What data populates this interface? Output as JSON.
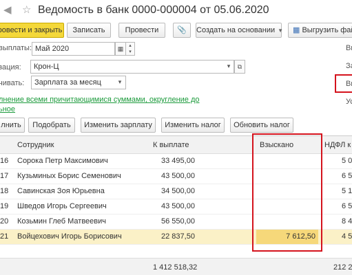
{
  "window": {
    "title": "Ведомость в банк 0000-000004 от 05.06.2020"
  },
  "toolbar": {
    "post_close": "ровести и закрыть",
    "write": "Записать",
    "post": "Провести",
    "create_based": "Создать на основании",
    "upload": "Выгрузить файл"
  },
  "form": {
    "month_label": "выплаты:",
    "month_value": "Май 2020",
    "org_label": "зация:",
    "org_value": "Крон-Ц",
    "pay_label": "чивать:",
    "pay_value": "Зарплата за месяц",
    "fill_link": "лнение всеми причитающимися суммами, округление до",
    "fill_link_2": "ьное",
    "right_1": "Вы",
    "right_2": "За",
    "right_3": "Вы",
    "right_4": "Ус"
  },
  "actions": {
    "fill": "лнить",
    "select": "Подобрать",
    "change_salary": "Изменить зарплату",
    "change_tax": "Изменить налог",
    "update_tax": "Обновить налог"
  },
  "table": {
    "headers": {
      "employee": "Сотрудник",
      "to_pay": "К выплате",
      "recovered": "Взыскано",
      "ndfl": "НДФЛ к"
    },
    "rows": [
      {
        "n": "16",
        "employee": "Сорока Петр Максимович",
        "to_pay": "33 495,00",
        "recovered": "",
        "ndfl": "5 0"
      },
      {
        "n": "17",
        "employee": "Кузьминых Борис Семенович",
        "to_pay": "43 500,00",
        "recovered": "",
        "ndfl": "6 5"
      },
      {
        "n": "18",
        "employee": "Савинская Зоя Юрьевна",
        "to_pay": "34 500,00",
        "recovered": "",
        "ndfl": "5 1"
      },
      {
        "n": "19",
        "employee": "Шведов Игорь Сергеевич",
        "to_pay": "43 500,00",
        "recovered": "",
        "ndfl": "6 5"
      },
      {
        "n": "20",
        "employee": "Козьмин Глеб Матвеевич",
        "to_pay": "56 550,00",
        "recovered": "",
        "ndfl": "8 4"
      },
      {
        "n": "21",
        "employee": "Войцехович Игорь Борисович",
        "to_pay": "22 837,50",
        "recovered": "7 612,50",
        "ndfl": "4 5"
      }
    ],
    "totals": {
      "to_pay": "1 412 518,32",
      "ndfl": "212 2"
    }
  }
}
